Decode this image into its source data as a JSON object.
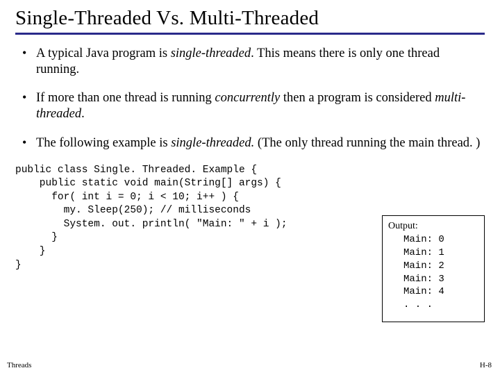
{
  "slide": {
    "title": "Single-Threaded Vs. Multi-Threaded",
    "bullets": [
      {
        "pre": "A typical Java program is ",
        "em": "single-threaded",
        "post": ". This means there is only one thread running."
      },
      {
        "pre": "If more than one thread is running ",
        "em": "concurrently",
        "post2_pre": " then a program is considered ",
        "em2": "multi-threaded",
        "post2": "."
      },
      {
        "pre": "The following example is ",
        "em": "single-threaded.",
        "post": "  (The only thread running the main thread. )"
      }
    ],
    "code": "public class Single. Threaded. Example {\n    public static void main(String[] args) {\n      for( int i = 0; i < 10; i++ ) {\n        my. Sleep(250); // milliseconds\n        System. out. println( \"Main: \" + i );\n      }\n    }\n}",
    "output": {
      "label": "Output:",
      "lines": [
        "Main: 0",
        "Main: 1",
        "Main: 2",
        "Main: 3",
        "Main: 4",
        ". . ."
      ]
    },
    "footer_left": "Threads",
    "footer_right": "H-8"
  }
}
